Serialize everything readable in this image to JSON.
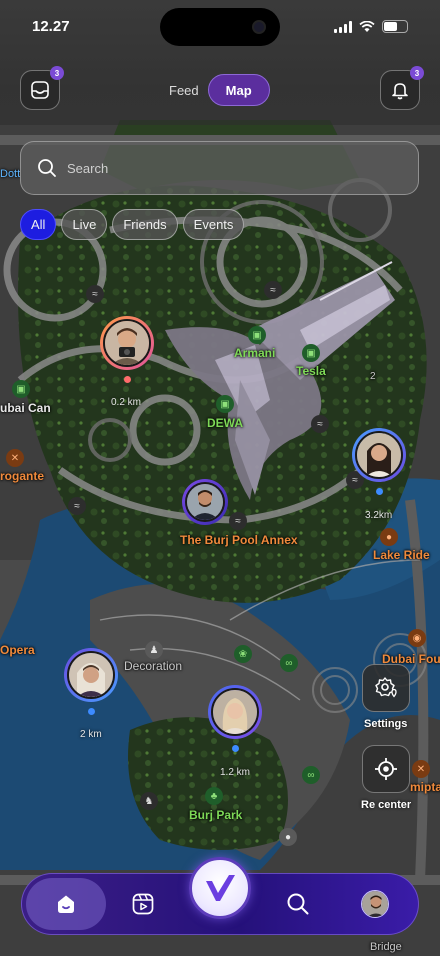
{
  "status_bar": {
    "time": "12.27"
  },
  "header": {
    "inbox_badge": "3",
    "tabs": [
      {
        "label": "Feed",
        "active": false
      },
      {
        "label": "Map",
        "active": true
      }
    ],
    "notification_badge": "3"
  },
  "search": {
    "placeholder": "Search"
  },
  "filters": [
    {
      "label": "All",
      "active": true
    },
    {
      "label": "Live",
      "active": false
    },
    {
      "label": "Friends",
      "active": false
    },
    {
      "label": "Events",
      "active": false
    }
  ],
  "map": {
    "labels": {
      "armani": "Armani",
      "tesla": "Tesla",
      "dewa": "DEWA",
      "dubai_can": "ubai Can",
      "rogante": "rogante",
      "burj_pool_annex": "The Burj Pool Annex",
      "lake_ride": "Lake Ride",
      "opera": "Opera",
      "decoration": "Decoration",
      "dubai_fountain": "Dubai Foun",
      "burj_park": "Burj Park",
      "miptar": "miptar",
      "bridge": "Bridge",
      "dotto": "Dott",
      "road_number": "2"
    },
    "users": [
      {
        "distance": "0.2 km",
        "ring": "#f07a3a",
        "dot": "#ff6b6b"
      },
      {
        "distance": "",
        "ring": "#6a3fd8",
        "dot": ""
      },
      {
        "distance": "3.2km",
        "ring": "#3d7ff5",
        "dot": "#3d8bff"
      },
      {
        "distance": "2 km",
        "ring": "#6a3fd8",
        "dot": "#3d8bff"
      },
      {
        "distance": "1.2 km",
        "ring": "#4a6cf0",
        "dot": "#3d8bff"
      }
    ]
  },
  "side_buttons": {
    "settings": "Settings",
    "recenter": "Re center"
  },
  "bottom_nav": {
    "items": [
      "home-icon",
      "reels-icon",
      "logo-icon",
      "search-icon",
      "profile-avatar"
    ]
  },
  "colors": {
    "accent": "#5b2e9e",
    "chip_active": "#1d1de0",
    "nav": "#25117a"
  }
}
